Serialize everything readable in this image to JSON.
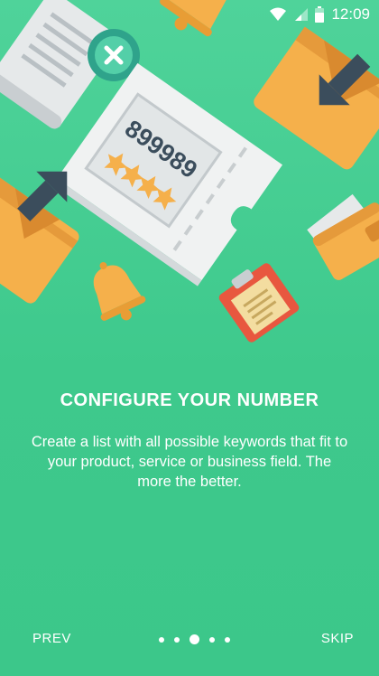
{
  "status_bar": {
    "time": "12:09",
    "icons": [
      "wifi-icon",
      "signal-icon",
      "battery-icon"
    ]
  },
  "illustration": {
    "ticket_number": "899989",
    "rating_stars": 4
  },
  "onboarding": {
    "title": "CONFIGURE YOUR NUMBER",
    "description": "Create a list with all possible keywords that fit to your product, service or business field. The more the better."
  },
  "navigation": {
    "prev_label": "PREV",
    "skip_label": "SKIP",
    "pages": 5,
    "current_page": 3
  },
  "colors": {
    "background": "#3fca8c",
    "text": "#ffffff",
    "folder": "#f5b04b",
    "arrow": "#3b4d5c"
  }
}
